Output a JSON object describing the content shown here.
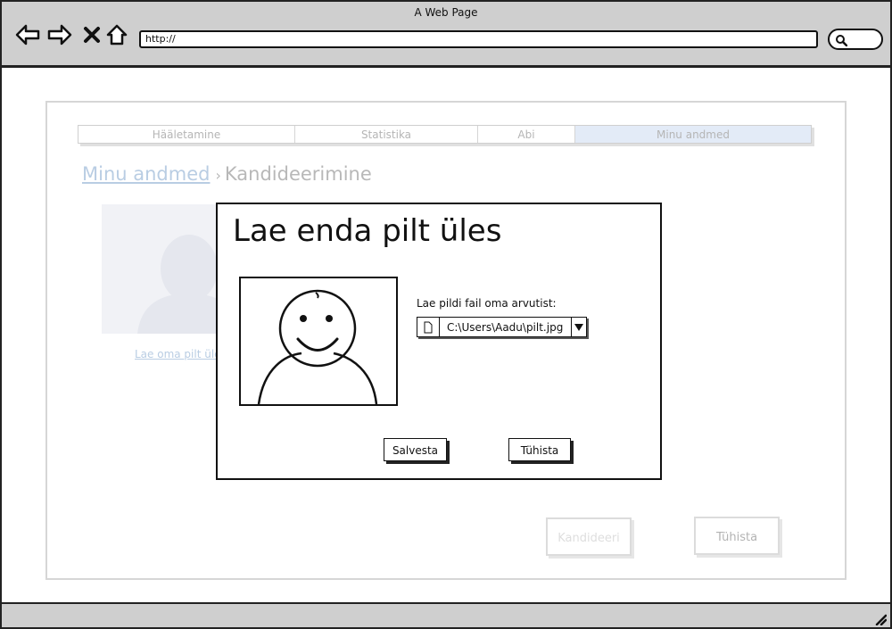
{
  "browser": {
    "window_title": "A Web Page",
    "url": "http://"
  },
  "tabs": [
    {
      "label": "Hääletamine",
      "active": false
    },
    {
      "label": "Statistika",
      "active": false
    },
    {
      "label": "Abi",
      "active": false
    },
    {
      "label": "Minu andmed",
      "active": true
    }
  ],
  "breadcrumb": {
    "link": "Minu andmed",
    "separator": "›",
    "current": "Kandideerimine"
  },
  "profile": {
    "upload_link": "Lae oma pilt üle"
  },
  "actions": {
    "candidate_label": "Kandideeri",
    "cancel_label": "Tühista"
  },
  "modal": {
    "title": "Lae enda pilt üles",
    "file_label": "Lae pildi fail oma arvutist:",
    "file_path": "C:\\Users\\Aadu\\pilt.jpg",
    "save_label": "Salvesta",
    "cancel_label": "Tühista"
  },
  "colors": {
    "chrome": "#cfcfcf",
    "active_tab": "#e3ebf7",
    "link_faded": "#b9cde3"
  }
}
